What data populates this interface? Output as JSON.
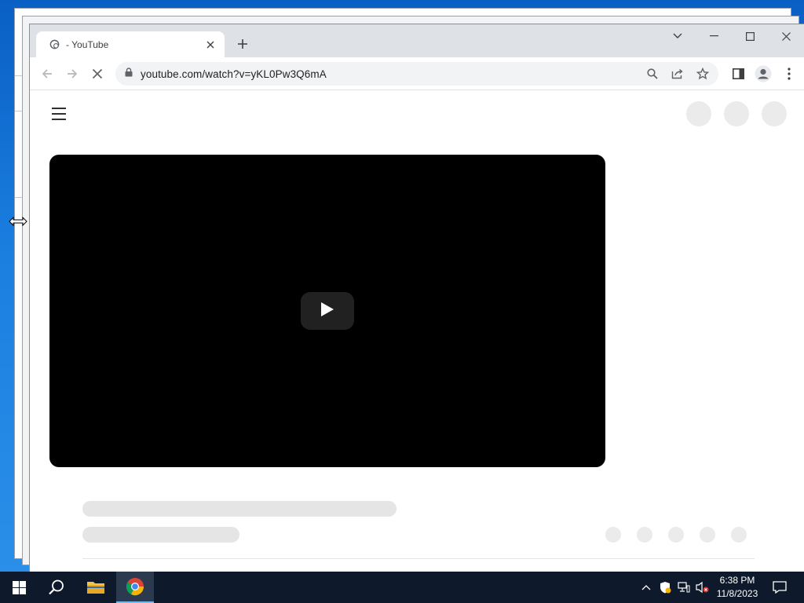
{
  "browser": {
    "tab": {
      "title": " - YouTube"
    },
    "address_bar": {
      "url": "youtube.com/watch?v=yKL0Pw3Q6mA"
    }
  },
  "icons": {
    "tab_favicon": "loading-globe-icon",
    "tab_close": "close-icon",
    "new_tab": "plus-icon",
    "tab_search": "chevron-down-icon",
    "minimize": "minimize-icon",
    "maximize": "maximize-icon",
    "close_window": "close-icon",
    "back": "back-arrow-icon",
    "forward": "forward-arrow-icon",
    "reload_stop": "stop-loading-icon",
    "lock": "lock-icon",
    "zoom": "search-icon",
    "share": "share-icon",
    "bookmark": "star-icon",
    "side_panel": "side-panel-icon",
    "profile": "profile-icon",
    "menu": "more-vert-icon",
    "guide": "hamburger-icon",
    "play": "play-icon",
    "resize_cursor": "horizontal-resize-cursor-icon",
    "start": "windows-logo-icon",
    "search": "search-icon",
    "file_explorer": "folder-icon",
    "chrome": "chrome-icon",
    "tray_overflow": "chevron-up-icon",
    "tray_defender": "shield-warning-icon",
    "tray_network": "network-icon",
    "tray_volume": "volume-muted-icon",
    "notifications": "notification-icon"
  },
  "taskbar": {
    "clock": {
      "time": "6:38 PM",
      "date": "11/8/2023"
    }
  },
  "colors": {
    "desktop": "#1b7fe0",
    "taskbar": "#0e1a2b",
    "chrome_frame": "#dee1e6",
    "player": "#000000",
    "skeleton": "#e5e5e5"
  }
}
